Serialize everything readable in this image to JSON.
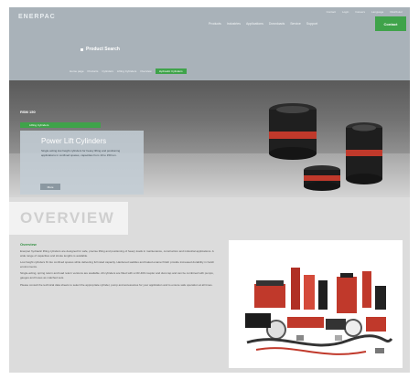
{
  "header": {
    "logo": "ENERPAC",
    "top_links": [
      "Contact",
      "Login",
      "Careers",
      "Language",
      "Distributor"
    ],
    "nav": [
      "Products",
      "Industries",
      "Applications",
      "Downloads",
      "Service",
      "Support"
    ],
    "cta": "Contact",
    "page_title": "Product Search"
  },
  "breadcrumbs": {
    "items": [
      "Home page",
      "Products",
      "Cylinders",
      "Lifting Cylinders",
      "Overview"
    ],
    "active": "Hydraulic Cylinders"
  },
  "hero": {
    "tag": "RSM 150",
    "tag_bar": "Lifting Cylinders",
    "title": "Power Lift Cylinders",
    "description": "Single acting low height cylinders for heavy lifting and positioning applications in confined spaces, capacities from 10 to 150 ton.",
    "more": "More"
  },
  "overview": {
    "title": "OVERVIEW",
    "subtitle": "Overview",
    "paragraphs": [
      "Enerpac hydraulic lifting cylinders are designed for safe, precise lifting and positioning of heavy loads in maintenance, construction and industrial applications. A wide range of capacities and stroke lengths is available.",
      "Low height cylinders fit into confined spaces while delivering full rated capacity. Hardened saddles and baked enamel finish provide increased durability in harsh environments.",
      "Single-acting, spring return and load return versions are available. All cylinders are fitted with a CR-400 coupler and dust cap and can be combined with pumps, gauges and hoses as matched sets.",
      "Please consult the technical data sheets to select the appropriate cylinder, pump and accessories for your application and to ensure safe operation at all times."
    ]
  },
  "colors": {
    "header_bg": "#a9b2b9",
    "accent_green": "#3fa34a",
    "cylinder_red": "#c0392b",
    "page_bg": "#dcdcdc"
  },
  "icons": {
    "title_bullet": "square-bullet-icon"
  }
}
